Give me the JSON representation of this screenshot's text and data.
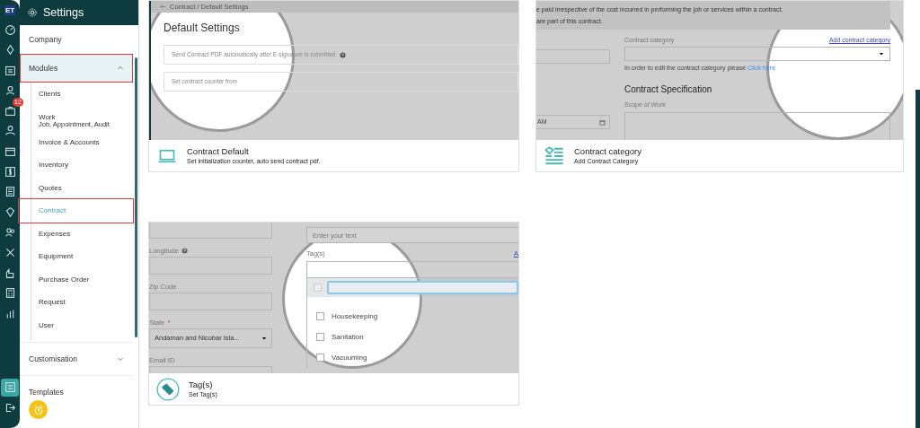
{
  "rail": {
    "logo": "ET",
    "items": [
      {
        "selected": false
      },
      {
        "selected": false
      },
      {
        "selected": false
      },
      {
        "selected": false
      },
      {
        "selected": false,
        "badge": "12"
      },
      {
        "selected": false
      },
      {
        "selected": false
      },
      {
        "selected": false
      },
      {
        "selected": false
      },
      {
        "selected": false
      },
      {
        "selected": false
      },
      {
        "selected": false
      },
      {
        "selected": false
      },
      {
        "selected": false
      },
      {
        "selected": false
      }
    ],
    "bottom_items": [
      {
        "selected": true
      },
      {
        "selected": false
      }
    ]
  },
  "sidebar": {
    "title": "Settings",
    "items": [
      {
        "label": "Company",
        "selected": false,
        "outlined": false
      },
      {
        "label": "Modules",
        "selected": true,
        "outlined": true,
        "expanded": true,
        "children": [
          {
            "label": "Clients",
            "selected": false,
            "outlined": false
          },
          {
            "label": "Work",
            "note": "Job, Appointment, Audit",
            "selected": false,
            "outlined": false
          },
          {
            "label": "Invoice & Accounts",
            "selected": false,
            "outlined": false
          },
          {
            "label": "Inventory",
            "selected": false,
            "outlined": false
          },
          {
            "label": "Quotes",
            "selected": false,
            "outlined": false
          },
          {
            "label": "Contract",
            "selected": true,
            "outlined": true
          },
          {
            "label": "Expenses",
            "selected": false,
            "outlined": false
          },
          {
            "label": "Equipment",
            "selected": false,
            "outlined": false
          },
          {
            "label": "Purchase Order",
            "selected": false,
            "outlined": false
          },
          {
            "label": "Request",
            "selected": false,
            "outlined": false
          },
          {
            "label": "User",
            "selected": false,
            "outlined": false
          }
        ]
      },
      {
        "label": "Customisation",
        "selected": false,
        "outlined": false,
        "expanded": false
      },
      {
        "label": "Templates",
        "selected": false,
        "outlined": false
      }
    ]
  },
  "cards": [
    {
      "kind": "default",
      "title": "Contract Default",
      "subtitle": "Set initialization counter, auto send contract pdf.",
      "preview": {
        "breadcrumb": "Contract / Default Settings",
        "heading": "Default Settings",
        "rows": [
          "Send Contract PDF automatically after E-signature is submitted.",
          "Set contract counter from"
        ]
      }
    },
    {
      "kind": "category",
      "title": "Contract category",
      "subtitle": "Add Contract Category",
      "preview": {
        "notice": [
          "e paid irrespective of the cost incurred in performing the job or services within a contract.",
          "are part of this contract."
        ],
        "time_value": "AM",
        "field_label": "Contract category",
        "link": "Add contract category",
        "help": "In order to edit the contract category please ",
        "help_link": "Click here",
        "heading": "Contract Specification",
        "textarea_label": "Scope of Work"
      }
    },
    {
      "kind": "tags",
      "title": "Tag(s)",
      "subtitle": "Set Tag(s)",
      "preview": {
        "left_fields": [
          {
            "label": "Longitude",
            "help": true
          },
          {
            "label": "Zip Code"
          },
          {
            "label": "State",
            "required_mark": "*",
            "value": "Andaman and Nicobar Isla..."
          },
          {
            "label": "Email ID"
          }
        ],
        "search_checked": false,
        "placeholder": "Enter your text",
        "tags_label": "Tag(s)",
        "tags_link": "A",
        "options": [
          {
            "label": "Housekeeping",
            "checked": false
          },
          {
            "label": "Sanitation",
            "checked": false
          },
          {
            "label": "Vacuuming",
            "checked": false
          }
        ]
      }
    }
  ]
}
